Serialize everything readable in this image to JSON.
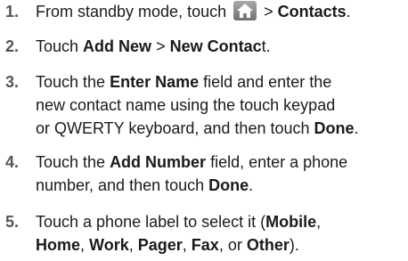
{
  "step1": {
    "number": "1.",
    "t1": "From standby mode, touch ",
    "icon": "home-icon",
    "t2": " > ",
    "b1": "Contacts",
    "t3": "."
  },
  "step2": {
    "number": "2.",
    "t1": "Touch ",
    "b1": "Add New",
    "t2": " > ",
    "b2": "New Contac",
    "t3": "t."
  },
  "step3": {
    "number": "3.",
    "t1": "Touch the ",
    "b1": "Enter Name",
    "t2": " field and enter the",
    "line2": "new contact name using the touch keypad",
    "l3t1": "or QWERTY keyboard, and then touch ",
    "l3b1": "Done",
    "l3t2": "."
  },
  "step4": {
    "number": "4.",
    "t1": "Touch the ",
    "b1": "Add Number",
    "t2": " field, enter a phone",
    "l2t1": "number, and then touch ",
    "l2b1": "Done",
    "l2t2": "."
  },
  "step5": {
    "number": "5.",
    "t1": "Touch a phone label to select it (",
    "b1": "Mobile",
    "t2": ",",
    "l2b1": "Home",
    "l2t1": ", ",
    "l2b2": "Work",
    "l2t2": ", ",
    "l2b3": "Pager",
    "l2t3": ", ",
    "l2b4": "Fax",
    "l2t4": ", or ",
    "l2b5": "Other",
    "l2t5": ")."
  }
}
